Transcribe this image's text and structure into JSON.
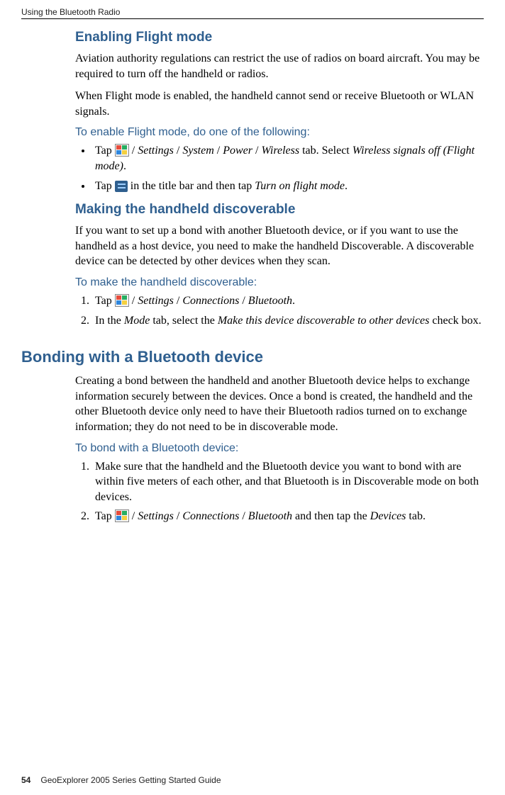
{
  "header": {
    "running": "Using the Bluetooth Radio"
  },
  "footer": {
    "page": "54",
    "guide": "GeoExplorer 2005 Series Getting Started Guide"
  },
  "sec1": {
    "title": "Enabling Flight mode",
    "p1": "Aviation authority regulations can restrict the use of radios on board aircraft. You may be required to turn off the handheld or radios.",
    "p2": "When Flight mode is enabled, the handheld cannot send or receive Bluetooth or WLAN signals.",
    "intro": "To enable Flight mode, do one of the following:",
    "b1a": "Tap ",
    "b1b": " / ",
    "b1_settings": "Settings",
    "b1_system": "System",
    "b1_power": "Power",
    "b1_wireless": "Wireless",
    "b1_tab": " tab. Select ",
    "b1_sig": "Wireless signals off (Flight mode)",
    "b1_dot": ".",
    "b2a": "Tap ",
    "b2b": " in the title bar and then tap ",
    "b2_turn": "Turn on flight mode",
    "b2_dot": "."
  },
  "sec2": {
    "title": "Making the handheld discoverable",
    "p1": "If you want to set up a bond with another Bluetooth device, or if you want to use the handheld as a host device, you need to make the handheld Discoverable. A discoverable device can be detected by other devices when they scan.",
    "intro": "To make the handheld discoverable:",
    "s1a": "Tap ",
    "s1b": " / ",
    "s1_settings": "Settings",
    "s1_conn": "Connections",
    "s1_bt": "Bluetooth",
    "s1_dot": ".",
    "s2a": "In the ",
    "s2_mode": "Mode",
    "s2b": " tab, select the ",
    "s2_make": "Make this device discoverable to other devices",
    "s2c": " check box."
  },
  "sec3": {
    "title": "Bonding with a Bluetooth device",
    "p1": "Creating a bond between the handheld and another Bluetooth device helps to exchange information securely between the devices. Once a bond is created, the handheld and the other Bluetooth device only need to have their Bluetooth radios turned on to exchange information; they do not need to be in discoverable mode.",
    "intro": "To bond with a Bluetooth device:",
    "s1": "Make sure that the handheld and the Bluetooth device you want to bond with are within five meters of each other, and that Bluetooth is in Discoverable mode on both devices.",
    "s2a": "Tap ",
    "s2b": " / ",
    "s2_settings": "Settings",
    "s2_conn": "Connections",
    "s2_bt": "Bluetooth",
    "s2c": " and then tap the ",
    "s2_dev": "Devices",
    "s2d": " tab."
  }
}
